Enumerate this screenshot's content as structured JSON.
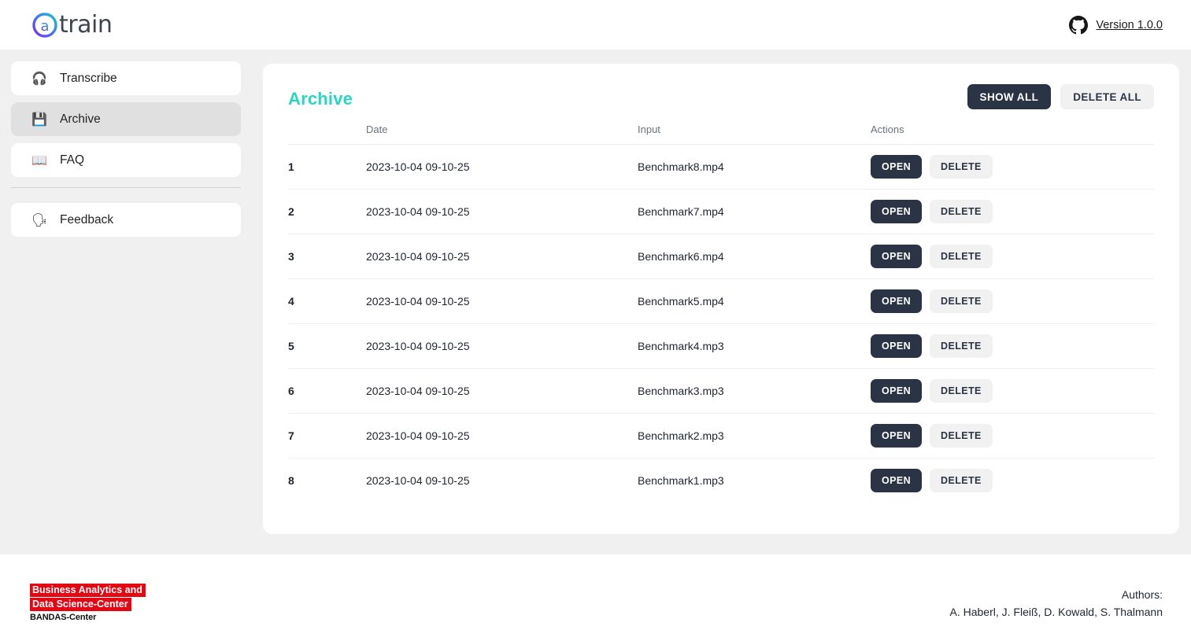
{
  "header": {
    "brand_word": "train",
    "brand_mark_icon": "circled-a-icon",
    "github_icon": "github-icon",
    "version_label": "Version 1.0.0"
  },
  "sidebar": {
    "items": [
      {
        "label": "Transcribe",
        "icon": "headphones-icon",
        "glyph": "🎧",
        "selected": false
      },
      {
        "label": "Archive",
        "icon": "floppy-disk-icon",
        "glyph": "💾",
        "selected": true
      },
      {
        "label": "FAQ",
        "icon": "open-book-icon",
        "glyph": "📖",
        "selected": false
      }
    ],
    "secondary_items": [
      {
        "label": "Feedback",
        "icon": "speaking-head-icon",
        "glyph": "🗣",
        "selected": false
      }
    ]
  },
  "archive": {
    "title": "Archive",
    "show_all_label": "SHOW ALL",
    "delete_all_label": "DELETE ALL",
    "columns": [
      "",
      "Date",
      "Input",
      "Actions"
    ],
    "open_label": "OPEN",
    "delete_label": "DELETE",
    "rows": [
      {
        "index": "1",
        "date": "2023-10-04 09-10-25",
        "input": "Benchmark8.mp4"
      },
      {
        "index": "2",
        "date": "2023-10-04 09-10-25",
        "input": "Benchmark7.mp4"
      },
      {
        "index": "3",
        "date": "2023-10-04 09-10-25",
        "input": "Benchmark6.mp4"
      },
      {
        "index": "4",
        "date": "2023-10-04 09-10-25",
        "input": "Benchmark5.mp4"
      },
      {
        "index": "5",
        "date": "2023-10-04 09-10-25",
        "input": "Benchmark4.mp3"
      },
      {
        "index": "6",
        "date": "2023-10-04 09-10-25",
        "input": "Benchmark3.mp3"
      },
      {
        "index": "7",
        "date": "2023-10-04 09-10-25",
        "input": "Benchmark2.mp3"
      },
      {
        "index": "8",
        "date": "2023-10-04 09-10-25",
        "input": "Benchmark1.mp3"
      }
    ]
  },
  "footer": {
    "bandas_line1": "Business Analytics and",
    "bandas_line2": "Data Science-Center",
    "bandas_sub": "BANDAS-Center",
    "authors_label": "Authors:",
    "authors_names": "A. Haberl, J. Fleiß, D. Kowald, S. Thalmann"
  },
  "colors": {
    "accent_teal": "#27d7c4",
    "dark_button": "#2b3445",
    "light_button": "#f1f1f1",
    "page_background": "#f0f0f0",
    "bandas_red": "#e30613"
  }
}
